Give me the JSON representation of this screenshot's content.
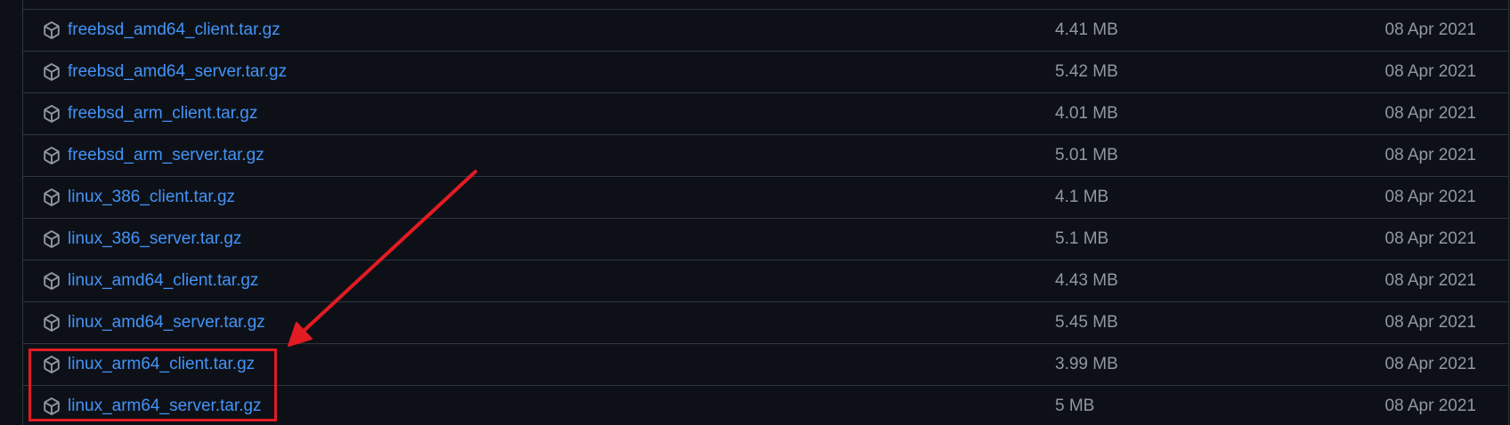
{
  "assets": [
    {
      "name": "freebsd_amd64_client.tar.gz",
      "size": "4.41 MB",
      "date": "08 Apr 2021"
    },
    {
      "name": "freebsd_amd64_server.tar.gz",
      "size": "5.42 MB",
      "date": "08 Apr 2021"
    },
    {
      "name": "freebsd_arm_client.tar.gz",
      "size": "4.01 MB",
      "date": "08 Apr 2021"
    },
    {
      "name": "freebsd_arm_server.tar.gz",
      "size": "5.01 MB",
      "date": "08 Apr 2021"
    },
    {
      "name": "linux_386_client.tar.gz",
      "size": "4.1 MB",
      "date": "08 Apr 2021"
    },
    {
      "name": "linux_386_server.tar.gz",
      "size": "5.1 MB",
      "date": "08 Apr 2021"
    },
    {
      "name": "linux_amd64_client.tar.gz",
      "size": "4.43 MB",
      "date": "08 Apr 2021"
    },
    {
      "name": "linux_amd64_server.tar.gz",
      "size": "5.45 MB",
      "date": "08 Apr 2021"
    },
    {
      "name": "linux_arm64_client.tar.gz",
      "size": "3.99 MB",
      "date": "08 Apr 2021"
    },
    {
      "name": "linux_arm64_server.tar.gz",
      "size": "5 MB",
      "date": "08 Apr 2021"
    }
  ],
  "icon": "package-icon",
  "colors": {
    "background": "#0d1117",
    "border": "#30363d",
    "link": "#4493f8",
    "muted_text": "#9198a1",
    "annotation": "#e31b23"
  },
  "annotation": {
    "highlighted_assets": [
      "linux_arm64_client.tar.gz",
      "linux_arm64_server.tar.gz"
    ]
  }
}
